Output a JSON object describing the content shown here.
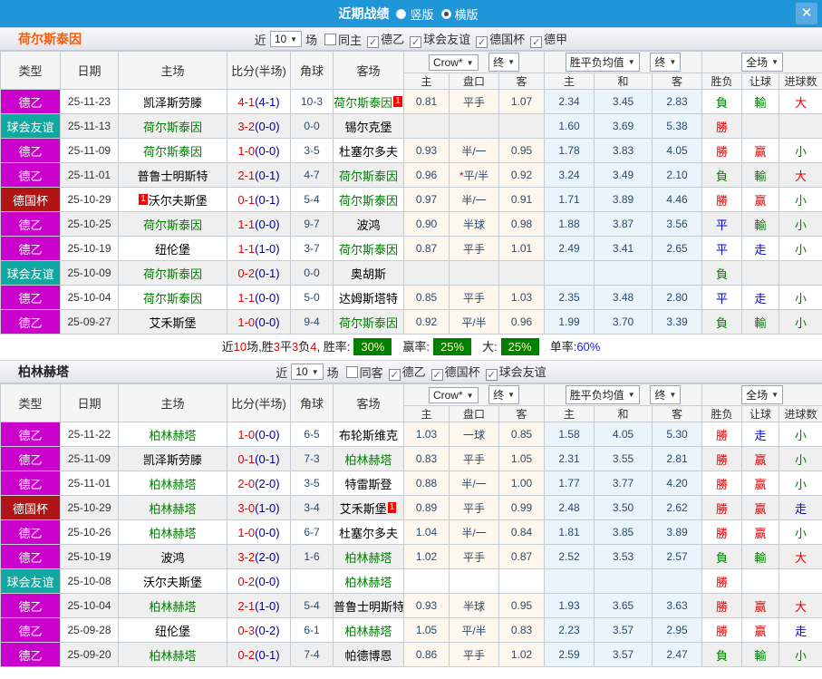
{
  "topbar": {
    "title": "近期战绩",
    "vertical_label": "竖版",
    "horizontal_label": "横版",
    "close_label": "✕"
  },
  "icons": {
    "dropdown": "▼",
    "check": "✓"
  },
  "col_headers": {
    "type": "类型",
    "date": "日期",
    "home": "主场",
    "score": "比分(半场)",
    "corner": "角球",
    "away": "客场",
    "crow": "Crow*",
    "final": "终",
    "mean": "胜平负均值",
    "full": "全场",
    "sub": [
      "主",
      "盘口",
      "客",
      "主",
      "和",
      "客",
      "胜负",
      "让球",
      "进球数"
    ]
  },
  "sections": [
    {
      "team": "荷尔斯泰因",
      "filter": {
        "near": "近",
        "count": "10",
        "unit": "场",
        "same_label": "同主",
        "same_checked": false,
        "leagues": [
          "德乙",
          "球会友谊",
          "德国杯",
          "德甲"
        ]
      },
      "rows": [
        {
          "type": "德乙",
          "tc": "#cc00cc",
          "date": "25-11-23",
          "home": "凯泽斯劳滕",
          "hf": false,
          "ft": "4-1",
          "ht": "(4-1)",
          "cor": "10-3",
          "away": "荷尔斯泰因",
          "af": true,
          "asa": "1",
          "h1": "0.81",
          "hc": "平手",
          "h2": "1.07",
          "m1": "2.34",
          "m2": "3.45",
          "m3": "2.83",
          "r1": "負",
          "c1": "green",
          "r2": "輸",
          "c2": "green",
          "r3": "大",
          "c3": "red"
        },
        {
          "type": "球会友谊",
          "tc": "#12a8a2",
          "date": "25-11-13",
          "home": "荷尔斯泰因",
          "hf": true,
          "ft": "3-2",
          "ht": "(0-0)",
          "cor": "0-0",
          "away": "锡尔克堡",
          "af": false,
          "h1": "",
          "hc": "",
          "h2": "",
          "m1": "1.60",
          "m2": "3.69",
          "m3": "5.38",
          "r1": "勝",
          "c1": "red",
          "r2": "",
          "c2": "",
          "r3": "",
          "c3": ""
        },
        {
          "type": "德乙",
          "tc": "#cc00cc",
          "date": "25-11-09",
          "home": "荷尔斯泰因",
          "hf": true,
          "ft": "1-0",
          "ht": "(0-0)",
          "cor": "3-5",
          "away": "杜塞尔多夫",
          "af": false,
          "h1": "0.93",
          "hc": "半/一",
          "h2": "0.95",
          "m1": "1.78",
          "m2": "3.83",
          "m3": "4.05",
          "r1": "勝",
          "c1": "red",
          "r2": "赢",
          "c2": "red",
          "r3": "小",
          "c3": "green"
        },
        {
          "type": "德乙",
          "tc": "#cc00cc",
          "date": "25-11-01",
          "home": "普鲁士明斯特",
          "hf": false,
          "ft": "2-1",
          "ht": "(0-1)",
          "cor": "4-7",
          "away": "荷尔斯泰因",
          "af": true,
          "h1": "0.96",
          "hc": "*平/半",
          "h2": "0.92",
          "m1": "3.24",
          "m2": "3.49",
          "m3": "2.10",
          "r1": "負",
          "c1": "green",
          "r2": "輸",
          "c2": "green",
          "r3": "大",
          "c3": "red"
        },
        {
          "type": "德国杯",
          "tc": "#b01414",
          "date": "25-10-29",
          "home": "沃尔夫斯堡",
          "hf": false,
          "hsb": "1",
          "ft": "0-1",
          "ht": "(0-1)",
          "cor": "5-4",
          "away": "荷尔斯泰因",
          "af": true,
          "h1": "0.97",
          "hc": "半/一",
          "h2": "0.91",
          "m1": "1.71",
          "m2": "3.89",
          "m3": "4.46",
          "r1": "勝",
          "c1": "red",
          "r2": "赢",
          "c2": "red",
          "r3": "小",
          "c3": "green"
        },
        {
          "type": "德乙",
          "tc": "#cc00cc",
          "date": "25-10-25",
          "home": "荷尔斯泰因",
          "hf": true,
          "ft": "1-1",
          "ht": "(0-0)",
          "cor": "9-7",
          "away": "波鸿",
          "af": false,
          "h1": "0.90",
          "hc": "半球",
          "h2": "0.98",
          "m1": "1.88",
          "m2": "3.87",
          "m3": "3.56",
          "r1": "平",
          "c1": "blue",
          "r2": "輸",
          "c2": "green",
          "r3": "小",
          "c3": "green"
        },
        {
          "type": "德乙",
          "tc": "#cc00cc",
          "date": "25-10-19",
          "home": "纽伦堡",
          "hf": false,
          "ft": "1-1",
          "ht": "(1-0)",
          "cor": "3-7",
          "away": "荷尔斯泰因",
          "af": true,
          "h1": "0.87",
          "hc": "平手",
          "h2": "1.01",
          "m1": "2.49",
          "m2": "3.41",
          "m3": "2.65",
          "r1": "平",
          "c1": "blue",
          "r2": "走",
          "c2": "blue",
          "r3": "小",
          "c3": "green"
        },
        {
          "type": "球会友谊",
          "tc": "#12a8a2",
          "date": "25-10-09",
          "home": "荷尔斯泰因",
          "hf": true,
          "ft": "0-2",
          "ht": "(0-1)",
          "cor": "0-0",
          "away": "奥胡斯",
          "af": false,
          "h1": "",
          "hc": "",
          "h2": "",
          "m1": "",
          "m2": "",
          "m3": "",
          "r1": "負",
          "c1": "green",
          "r2": "",
          "c2": "",
          "r3": "",
          "c3": ""
        },
        {
          "type": "德乙",
          "tc": "#cc00cc",
          "date": "25-10-04",
          "home": "荷尔斯泰因",
          "hf": true,
          "ft": "1-1",
          "ht": "(0-0)",
          "cor": "5-0",
          "away": "达姆斯塔特",
          "af": false,
          "h1": "0.85",
          "hc": "平手",
          "h2": "1.03",
          "m1": "2.35",
          "m2": "3.48",
          "m3": "2.80",
          "r1": "平",
          "c1": "blue",
          "r2": "走",
          "c2": "blue",
          "r3": "小",
          "c3": "green"
        },
        {
          "type": "德乙",
          "tc": "#cc00cc",
          "date": "25-09-27",
          "home": "艾禾斯堡",
          "hf": false,
          "ft": "1-0",
          "ht": "(0-0)",
          "cor": "9-4",
          "away": "荷尔斯泰因",
          "af": true,
          "h1": "0.92",
          "hc": "平/半",
          "h2": "0.96",
          "m1": "1.99",
          "m2": "3.70",
          "m3": "3.39",
          "r1": "負",
          "c1": "green",
          "r2": "輸",
          "c2": "green",
          "r3": "小",
          "c3": "green"
        }
      ],
      "summary": {
        "p1": "近",
        "n1": "10",
        "p2": "场,胜",
        "n2": "3",
        "p3": "平",
        "n3": "3",
        "p4": "负",
        "n4": "4",
        "p5": ", 胜率:",
        "b1": "30%",
        "p6": "赢率:",
        "b2": "25%",
        "p7": "大:",
        "b3": "25%",
        "p8": "单率:",
        "pct": "60%"
      }
    },
    {
      "team": "柏林赫塔",
      "filter": {
        "near": "近",
        "count": "10",
        "unit": "场",
        "same_label": "同客",
        "same_checked": false,
        "leagues": [
          "德乙",
          "德国杯",
          "球会友谊"
        ]
      },
      "rows": [
        {
          "type": "德乙",
          "tc": "#cc00cc",
          "date": "25-11-22",
          "home": "柏林赫塔",
          "hf": true,
          "ft": "1-0",
          "ht": "(0-0)",
          "cor": "6-5",
          "away": "布轮斯维克",
          "af": false,
          "h1": "1.03",
          "hc": "一球",
          "h2": "0.85",
          "m1": "1.58",
          "m2": "4.05",
          "m3": "5.30",
          "r1": "勝",
          "c1": "red",
          "r2": "走",
          "c2": "blue",
          "r3": "小",
          "c3": "green"
        },
        {
          "type": "德乙",
          "tc": "#cc00cc",
          "date": "25-11-09",
          "home": "凯泽斯劳滕",
          "hf": false,
          "ft": "0-1",
          "ht": "(0-1)",
          "cor": "7-3",
          "away": "柏林赫塔",
          "af": true,
          "h1": "0.83",
          "hc": "平手",
          "h2": "1.05",
          "m1": "2.31",
          "m2": "3.55",
          "m3": "2.81",
          "r1": "勝",
          "c1": "red",
          "r2": "赢",
          "c2": "red",
          "r3": "小",
          "c3": "green"
        },
        {
          "type": "德乙",
          "tc": "#cc00cc",
          "date": "25-11-01",
          "home": "柏林赫塔",
          "hf": true,
          "ft": "2-0",
          "ht": "(2-0)",
          "cor": "3-5",
          "away": "特雷斯登",
          "af": false,
          "h1": "0.88",
          "hc": "半/一",
          "h2": "1.00",
          "m1": "1.77",
          "m2": "3.77",
          "m3": "4.20",
          "r1": "勝",
          "c1": "red",
          "r2": "赢",
          "c2": "red",
          "r3": "小",
          "c3": "green"
        },
        {
          "type": "德国杯",
          "tc": "#b01414",
          "date": "25-10-29",
          "home": "柏林赫塔",
          "hf": true,
          "ft": "3-0",
          "ht": "(1-0)",
          "cor": "3-4",
          "away": "艾禾斯堡",
          "af": false,
          "asa": "1",
          "h1": "0.89",
          "hc": "平手",
          "h2": "0.99",
          "m1": "2.48",
          "m2": "3.50",
          "m3": "2.62",
          "r1": "勝",
          "c1": "red",
          "r2": "赢",
          "c2": "red",
          "r3": "走",
          "c3": "blue"
        },
        {
          "type": "德乙",
          "tc": "#cc00cc",
          "date": "25-10-26",
          "home": "柏林赫塔",
          "hf": true,
          "ft": "1-0",
          "ht": "(0-0)",
          "cor": "6-7",
          "away": "杜塞尔多夫",
          "af": false,
          "h1": "1.04",
          "hc": "半/一",
          "h2": "0.84",
          "m1": "1.81",
          "m2": "3.85",
          "m3": "3.89",
          "r1": "勝",
          "c1": "red",
          "r2": "赢",
          "c2": "red",
          "r3": "小",
          "c3": "green"
        },
        {
          "type": "德乙",
          "tc": "#cc00cc",
          "date": "25-10-19",
          "home": "波鸿",
          "hf": false,
          "ft": "3-2",
          "ht": "(2-0)",
          "cor": "1-6",
          "away": "柏林赫塔",
          "af": true,
          "h1": "1.02",
          "hc": "平手",
          "h2": "0.87",
          "m1": "2.52",
          "m2": "3.53",
          "m3": "2.57",
          "r1": "負",
          "c1": "green",
          "r2": "輸",
          "c2": "green",
          "r3": "大",
          "c3": "red"
        },
        {
          "type": "球会友谊",
          "tc": "#12a8a2",
          "date": "25-10-08",
          "home": "沃尔夫斯堡",
          "hf": false,
          "ft": "0-2",
          "ht": "(0-0)",
          "cor": "",
          "away": "柏林赫塔",
          "af": true,
          "h1": "",
          "hc": "",
          "h2": "",
          "m1": "",
          "m2": "",
          "m3": "",
          "r1": "勝",
          "c1": "red",
          "r2": "",
          "c2": "",
          "r3": "",
          "c3": ""
        },
        {
          "type": "德乙",
          "tc": "#cc00cc",
          "date": "25-10-04",
          "home": "柏林赫塔",
          "hf": true,
          "ft": "2-1",
          "ht": "(1-0)",
          "cor": "5-4",
          "away": "普鲁士明斯特",
          "af": false,
          "h1": "0.93",
          "hc": "半球",
          "h2": "0.95",
          "m1": "1.93",
          "m2": "3.65",
          "m3": "3.63",
          "r1": "勝",
          "c1": "red",
          "r2": "赢",
          "c2": "red",
          "r3": "大",
          "c3": "red"
        },
        {
          "type": "德乙",
          "tc": "#cc00cc",
          "date": "25-09-28",
          "home": "纽伦堡",
          "hf": false,
          "ft": "0-3",
          "ht": "(0-2)",
          "cor": "6-1",
          "away": "柏林赫塔",
          "af": true,
          "h1": "1.05",
          "hc": "平/半",
          "h2": "0.83",
          "m1": "2.23",
          "m2": "3.57",
          "m3": "2.95",
          "r1": "勝",
          "c1": "red",
          "r2": "赢",
          "c2": "red",
          "r3": "走",
          "c3": "blue"
        },
        {
          "type": "德乙",
          "tc": "#cc00cc",
          "date": "25-09-20",
          "home": "柏林赫塔",
          "hf": true,
          "ft": "0-2",
          "ht": "(0-1)",
          "cor": "7-4",
          "away": "帕德博恩",
          "af": false,
          "h1": "0.86",
          "hc": "平手",
          "h2": "1.02",
          "m1": "2.59",
          "m2": "3.57",
          "m3": "2.47",
          "r1": "負",
          "c1": "green",
          "r2": "輸",
          "c2": "green",
          "r3": "小",
          "c3": "green"
        }
      ]
    }
  ]
}
